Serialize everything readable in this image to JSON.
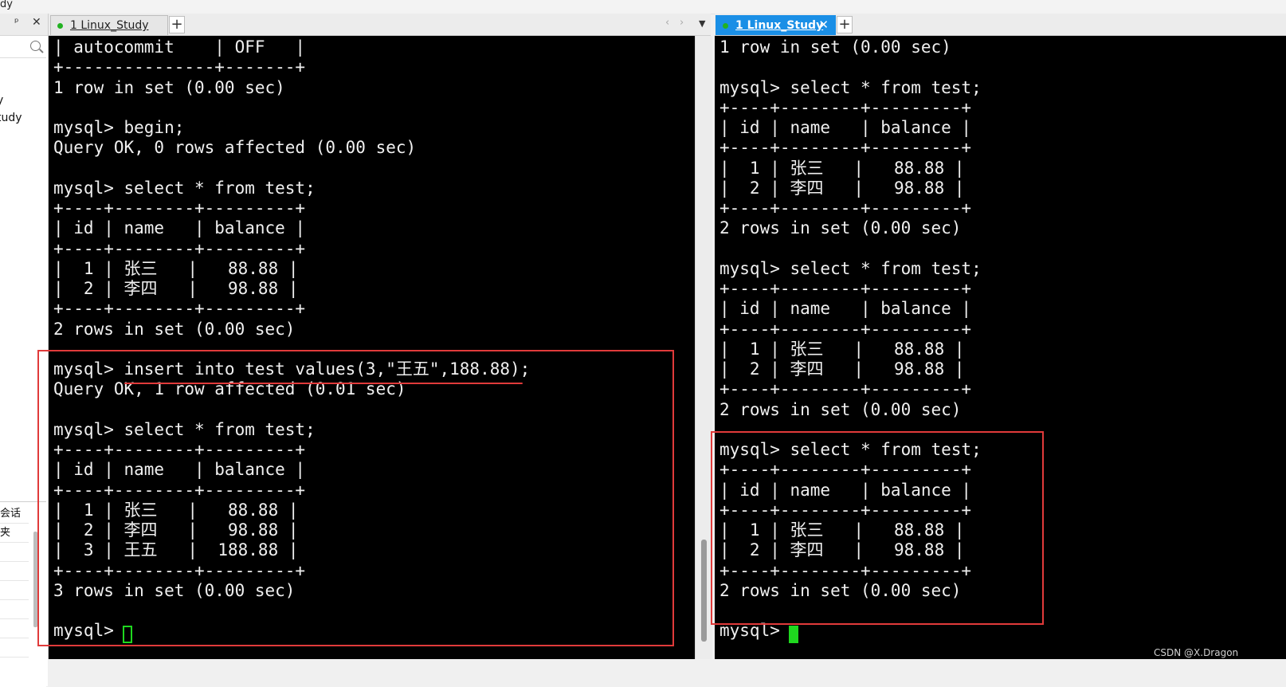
{
  "window": {
    "title_fragment": "dy"
  },
  "sidebar": {
    "items": [
      "y",
      "tudy"
    ],
    "props": [
      "会话",
      "夹"
    ]
  },
  "left_pane": {
    "tab": {
      "label": "1 Linux_Study"
    },
    "new_tab": "+",
    "lines": [
      "| autocommit    | OFF   |",
      "+---------------+-------+",
      "1 row in set (0.00 sec)",
      "",
      "mysql> begin;",
      "Query OK, 0 rows affected (0.00 sec)",
      "",
      "mysql> select * from test;",
      "+----+--------+---------+",
      "| id | name   | balance |",
      "+----+--------+---------+",
      "|  1 | 张三   |   88.88 |",
      "|  2 | 李四   |   98.88 |",
      "+----+--------+---------+",
      "2 rows in set (0.00 sec)",
      "",
      "mysql> insert into test values(3,\"王五\",188.88);",
      "Query OK, 1 row affected (0.01 sec)",
      "",
      "mysql> select * from test;",
      "+----+--------+---------+",
      "| id | name   | balance |",
      "+----+--------+---------+",
      "|  1 | 张三   |   88.88 |",
      "|  2 | 李四   |   98.88 |",
      "|  3 | 王五   |  188.88 |",
      "+----+--------+---------+",
      "3 rows in set (0.00 sec)",
      "",
      "mysql> "
    ]
  },
  "right_pane": {
    "tab": {
      "label": "1 Linux_Study"
    },
    "new_tab": "+",
    "lines": [
      "1 row in set (0.00 sec)",
      "",
      "mysql> select * from test;",
      "+----+--------+---------+",
      "| id | name   | balance |",
      "+----+--------+---------+",
      "|  1 | 张三   |   88.88 |",
      "|  2 | 李四   |   98.88 |",
      "+----+--------+---------+",
      "2 rows in set (0.00 sec)",
      "",
      "mysql> select * from test;",
      "+----+--------+---------+",
      "| id | name   | balance |",
      "+----+--------+---------+",
      "|  1 | 张三   |   88.88 |",
      "|  2 | 李四   |   98.88 |",
      "+----+--------+---------+",
      "2 rows in set (0.00 sec)",
      "",
      "mysql> select * from test;",
      "+----+--------+---------+",
      "| id | name   | balance |",
      "+----+--------+---------+",
      "|  1 | 张三   |   88.88 |",
      "|  2 | 李四   |   98.88 |",
      "+----+--------+---------+",
      "2 rows in set (0.00 sec)",
      "",
      "mysql> "
    ]
  },
  "colors": {
    "terminal_bg": "#000000",
    "terminal_fg": "#f0f0f0",
    "cursor": "#1fd81f",
    "annotation": "#e03a3a",
    "active_tab": "#1a8fe6",
    "session_dot": "#22b222"
  },
  "watermark": "CSDN @X.Dragon"
}
